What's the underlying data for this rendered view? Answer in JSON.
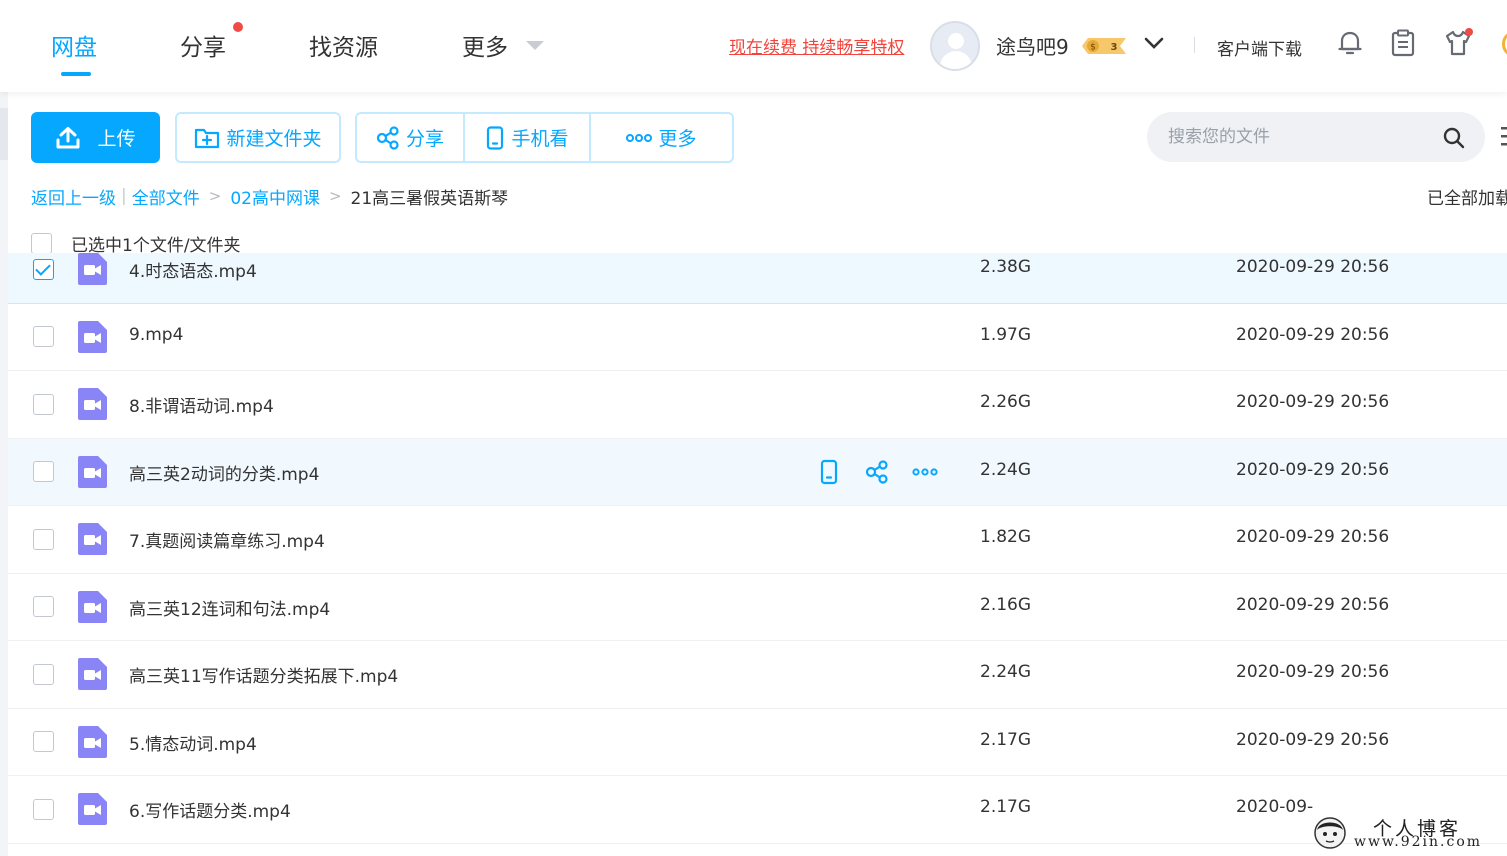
{
  "nav": {
    "tabs": [
      {
        "label": "网盘",
        "active": true
      },
      {
        "label": "分享",
        "active": false
      },
      {
        "label": "找资源",
        "active": false
      },
      {
        "label": "更多",
        "active": false
      }
    ],
    "renew_link": "现在续费 持续畅享特权",
    "username": "途鸟吧9",
    "vip_level": "3",
    "client_download": "客户端下载",
    "accent_color": "#06a7ff"
  },
  "toolbar": {
    "upload_label": "上传",
    "new_folder_label": "新建文件夹",
    "share_label": "分享",
    "phone_label": "手机看",
    "more_label": "更多",
    "search_placeholder": "搜索您的文件"
  },
  "breadcrumb": {
    "back": "返回上一级",
    "path": [
      "全部文件",
      "02高中网课"
    ],
    "current": "21高三暑假英语斯琴",
    "loaded_status": "已全部加载"
  },
  "selection": {
    "text": "已选中1个文件/文件夹"
  },
  "files": [
    {
      "name": "4.时态语态.mp4",
      "size": "2.38G",
      "date": "2020-09-29 20:56",
      "checked": true,
      "hover": false
    },
    {
      "name": "9.mp4",
      "size": "1.97G",
      "date": "2020-09-29 20:56",
      "checked": false,
      "hover": false
    },
    {
      "name": "8.非谓语动词.mp4",
      "size": "2.26G",
      "date": "2020-09-29 20:56",
      "checked": false,
      "hover": false
    },
    {
      "name": "高三英2动词的分类.mp4",
      "size": "2.24G",
      "date": "2020-09-29 20:56",
      "checked": false,
      "hover": true
    },
    {
      "name": "7.真题阅读篇章练习.mp4",
      "size": "1.82G",
      "date": "2020-09-29 20:56",
      "checked": false,
      "hover": false
    },
    {
      "name": "高三英12连词和句法.mp4",
      "size": "2.16G",
      "date": "2020-09-29 20:56",
      "checked": false,
      "hover": false
    },
    {
      "name": "高三英11写作话题分类拓展下.mp4",
      "size": "2.24G",
      "date": "2020-09-29 20:56",
      "checked": false,
      "hover": false
    },
    {
      "name": "5.情态动词.mp4",
      "size": "2.17G",
      "date": "2020-09-29 20:56",
      "checked": false,
      "hover": false
    },
    {
      "name": "6.写作话题分类.mp4",
      "size": "2.17G",
      "date": "2020-09-",
      "checked": false,
      "hover": false
    }
  ],
  "watermark": {
    "title": "个人博客",
    "url": "www.92in.com"
  }
}
